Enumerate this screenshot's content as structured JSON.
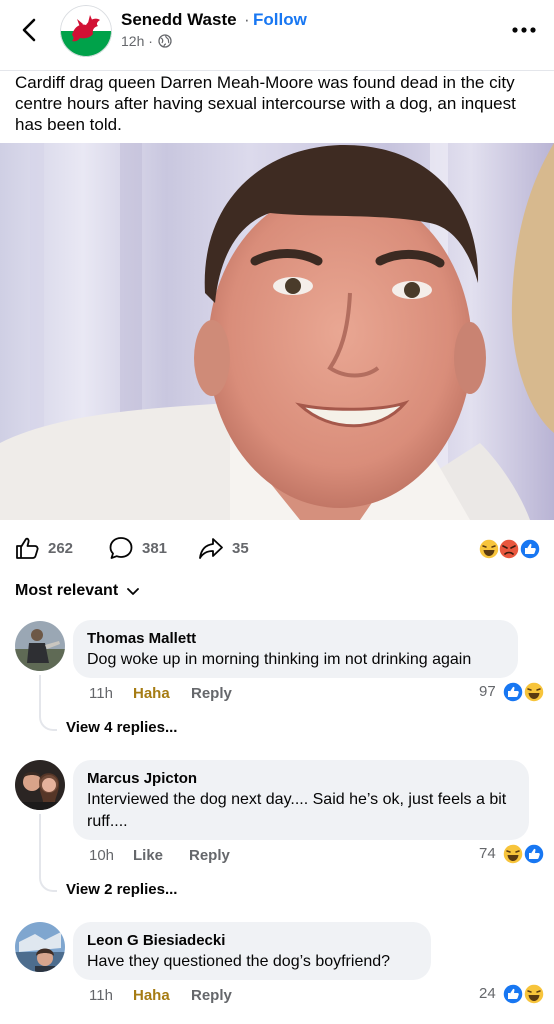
{
  "header": {
    "page_name": "Senedd Waste",
    "separator": "·",
    "follow_label": "Follow",
    "post_time": "12h ·"
  },
  "post": {
    "caption": "Cardiff drag queen Darren Meah-Moore was found dead in the city centre hours after having sexual intercourse with a dog, an inquest has been told.",
    "like_count": "262",
    "comment_count": "381",
    "share_count": "35"
  },
  "sort": {
    "label": "Most relevant"
  },
  "comments": [
    {
      "author": "Thomas Mallett",
      "text": "Dog woke up in morning thinking im not drinking again",
      "time": "11h",
      "reaction_label": "Haha",
      "reply_label": "Reply",
      "reaction_count": "97",
      "view_replies": "View 4 replies..."
    },
    {
      "author": "Marcus Jpicton",
      "text": "Interviewed the dog next day.... Said he’s ok, just feels a bit ruff....",
      "time": "10h",
      "reaction_label": "Like",
      "reply_label": "Reply",
      "reaction_count": "74",
      "view_replies": "View 2 replies..."
    },
    {
      "author": "Leon G Biesiadecki",
      "text": "Have they questioned the dog’s boyfriend?",
      "time": "11h",
      "reaction_label": "Haha",
      "reply_label": "Reply",
      "reaction_count": "24"
    }
  ],
  "colors": {
    "accent": "#1877f2",
    "haha_text": "#a67c14",
    "secondary_text": "#65676b",
    "bubble": "#f0f2f5"
  },
  "icons": [
    "back-arrow-icon",
    "globe-icon",
    "more-dots-icon",
    "like-thumb-icon",
    "comment-icon",
    "share-icon",
    "haha-emoji-icon",
    "angry-emoji-icon",
    "like-reaction-icon",
    "chevron-down-icon"
  ]
}
